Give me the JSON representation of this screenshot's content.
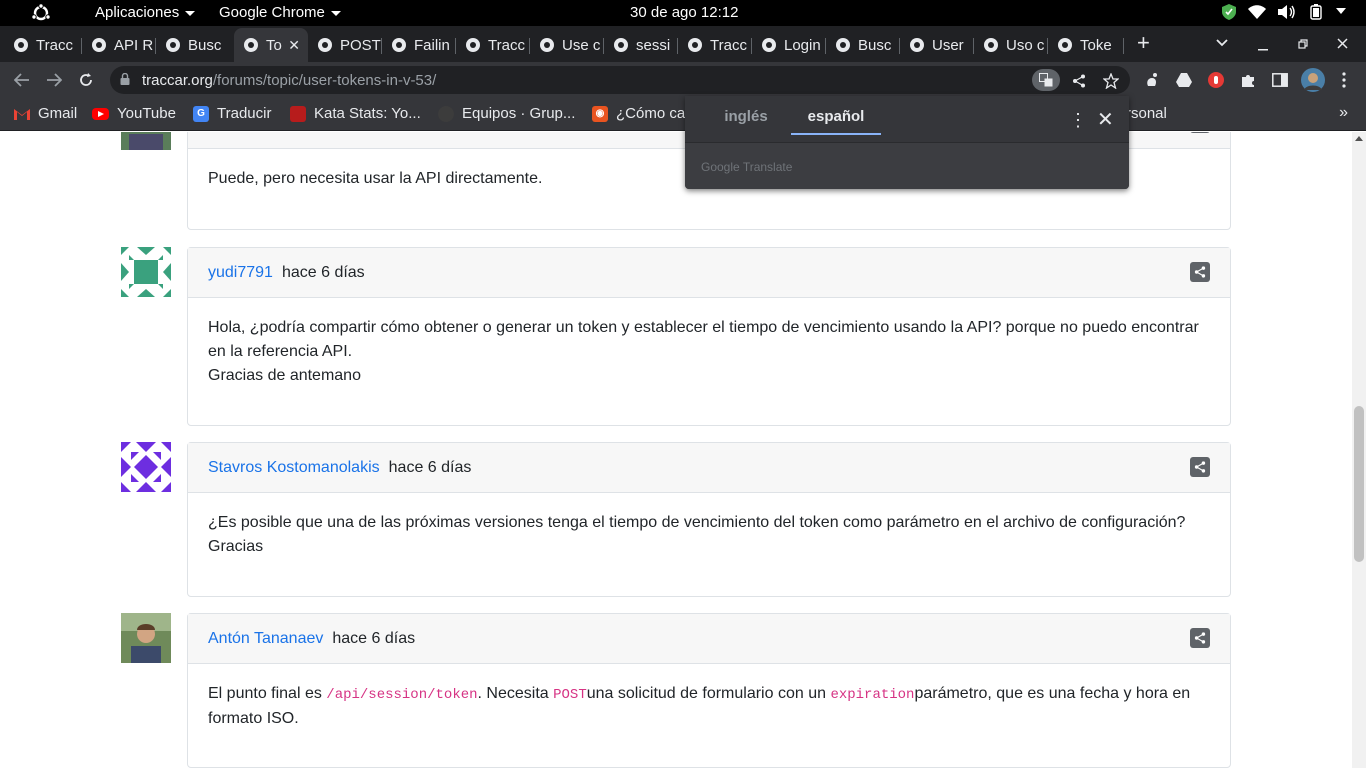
{
  "system_bar": {
    "apps_menu": "Aplicaciones",
    "app_menu": "Google Chrome",
    "clock": "30 de ago  12:12"
  },
  "tabs": [
    {
      "label": "Tracc"
    },
    {
      "label": "API R"
    },
    {
      "label": "Busc"
    },
    {
      "label": "To"
    },
    {
      "label": "POST"
    },
    {
      "label": "Failin"
    },
    {
      "label": "Tracc"
    },
    {
      "label": "Use c"
    },
    {
      "label": "sessi"
    },
    {
      "label": "Tracc"
    },
    {
      "label": "Login"
    },
    {
      "label": "Busc"
    },
    {
      "label": "User"
    },
    {
      "label": "Uso c"
    },
    {
      "label": "Toke"
    }
  ],
  "address_bar": {
    "domain": "traccar.org",
    "path": "/forums/topic/user-tokens-in-v-53/"
  },
  "bookmarks": [
    {
      "label": "Gmail",
      "icon": "gmail-icon",
      "color": "#ea4335"
    },
    {
      "label": "YouTube",
      "icon": "youtube-icon",
      "color": "#ff0000"
    },
    {
      "label": "Traducir",
      "icon": "google-translate-icon",
      "color": "#4285f4"
    },
    {
      "label": "Kata Stats: Yo...",
      "icon": "kata-icon",
      "color": "#b71c1c"
    },
    {
      "label": "Equipos · Grup...",
      "icon": "github-icon",
      "color": "#3c3c3c"
    },
    {
      "label": "¿Cómo car",
      "icon": "ubuntu-icon",
      "color": "#e95420"
    },
    {
      "label": "rsonal",
      "icon": "",
      "color": ""
    }
  ],
  "translate_popup": {
    "source_lang": "inglés",
    "target_lang": "español",
    "footer": "Google Translate"
  },
  "posts": [
    {
      "author": "",
      "time": "",
      "body": [
        "Puede, pero necesita usar la API directamente."
      ]
    },
    {
      "author": "yudi7791",
      "time": "hace 6 días",
      "body": [
        "Hola, ¿podría compartir cómo obtener o generar un token y establecer el tiempo de vencimiento usando la API? porque no puedo encontrar en la referencia API.",
        "Gracias de antemano"
      ]
    },
    {
      "author": "Stavros Kostomanolakis",
      "time": "hace 6 días",
      "body": [
        "¿Es posible que una de las próximas versiones tenga el tiempo de vencimiento del token como parámetro en el archivo de configuración?",
        "Gracias"
      ]
    },
    {
      "author": "Antón Tananaev",
      "time": "hace 6 días",
      "body_parts": {
        "t1": "El punto final es ",
        "c1": "/api/session/token",
        "t2": ". Necesita ",
        "c2": "POST",
        "t3": "una solicitud de formulario con un ",
        "c3": "expiration",
        "t4": "parámetro, que es una fecha y hora en formato ISO."
      }
    }
  ],
  "colors": {
    "link": "#1a73e8",
    "code": "#d63384",
    "chrome_dark": "#202124",
    "chrome_toolbar": "#35363a"
  }
}
